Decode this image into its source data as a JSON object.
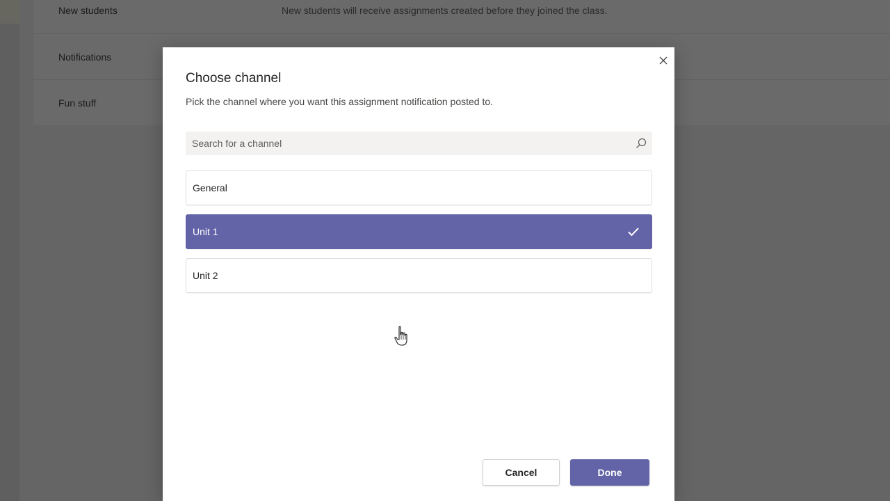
{
  "background": {
    "settings_rows": [
      {
        "label": "New students",
        "description": "New students will receive assignments created before they joined the class."
      },
      {
        "label": "Notifications",
        "description": ""
      },
      {
        "label": "Fun stuff",
        "description": ""
      }
    ]
  },
  "dialog": {
    "title": "Choose channel",
    "subtitle": "Pick the channel where you want this assignment notification posted to.",
    "search": {
      "placeholder": "Search for a channel",
      "value": "",
      "icon": "search-icon"
    },
    "close_icon": "close-icon",
    "channels": [
      {
        "label": "General",
        "selected": false
      },
      {
        "label": "Unit 1",
        "selected": true
      },
      {
        "label": "Unit 2",
        "selected": false
      }
    ],
    "buttons": {
      "cancel_label": "Cancel",
      "done_label": "Done"
    }
  },
  "colors": {
    "accent": "#6264a7",
    "overlay": "#656565"
  }
}
